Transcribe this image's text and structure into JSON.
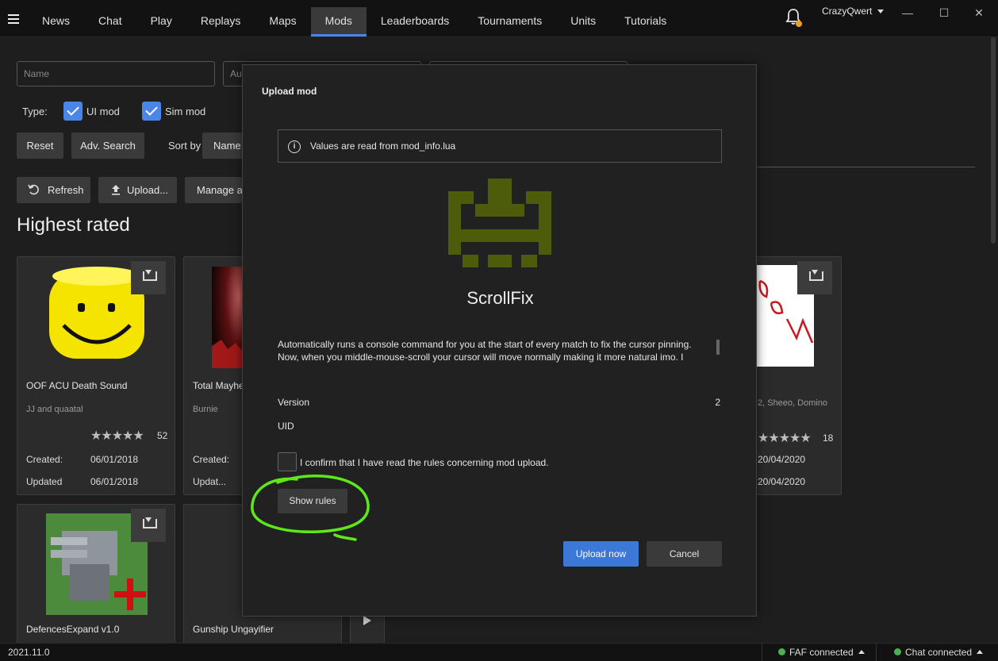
{
  "topbar": {
    "tabs": [
      "News",
      "Chat",
      "Play",
      "Replays",
      "Maps",
      "Mods",
      "Leaderboards",
      "Tournaments",
      "Units",
      "Tutorials"
    ],
    "active_tab": "Mods",
    "username": "CrazyQwert",
    "window_buttons": [
      "—",
      "☐",
      "✕"
    ]
  },
  "search": {
    "name_placeholder": "Name",
    "author_placeholder": "Au",
    "type_label": "Type:",
    "ui_mod_label": "UI mod",
    "sim_mod_label": "Sim mod",
    "reset_label": "Reset",
    "adv_search_label": "Adv. Search",
    "sort_by_label": "Sort by",
    "sort_value": "Name"
  },
  "actions": {
    "refresh_label": "Refresh",
    "upload_label": "Upload...",
    "manage_label": "Manage ac"
  },
  "section_title": "Highest rated",
  "cards": [
    {
      "title": "OOF ACU Death Sound",
      "author": "JJ and quaatal",
      "stars": "★★★★★",
      "rating_count": "52",
      "created_label": "Created:",
      "created": "06/01/2018",
      "updated_label": "Updated",
      "updated": "06/01/2018"
    },
    {
      "title": "Total Mayhe",
      "author": "Burnie",
      "created_label": "Created:",
      "updated_label": "Updat..."
    },
    {
      "author": "2, Sheeo, Domino",
      "stars": "★★★★★",
      "rating_count": "18",
      "created": "20/04/2020",
      "updated": "20/04/2020"
    },
    {
      "title": "DefencesExpand v1.0"
    },
    {
      "title": "Gunship Ungayifier"
    }
  ],
  "modal": {
    "title": "Upload mod",
    "info_text": "Values are read from mod_info.lua",
    "mod_name": "ScrollFix",
    "description_line1": "Automatically runs a console command for you at the start of every match to fix the cursor pinning.",
    "description_line2": "Now, when you middle-mouse-scroll your cursor will move normally making it more natural imo. I",
    "version_label": "Version",
    "version_value": "2",
    "uid_label": "UID",
    "uid_value": "",
    "confirm_label": "I confirm that I have read the rules concerning mod upload.",
    "show_rules_label": "Show rules",
    "upload_now_label": "Upload now",
    "cancel_label": "Cancel",
    "icon_color": "#4d5c0a",
    "annotation_color": "#5ee81c"
  },
  "statusbar": {
    "version": "2021.11.0",
    "faf_status": "FAF connected",
    "chat_status": "Chat connected"
  },
  "colors": {
    "accent": "#4a86e8",
    "background": "#1e1e1e",
    "status_ok": "#4caf50"
  }
}
